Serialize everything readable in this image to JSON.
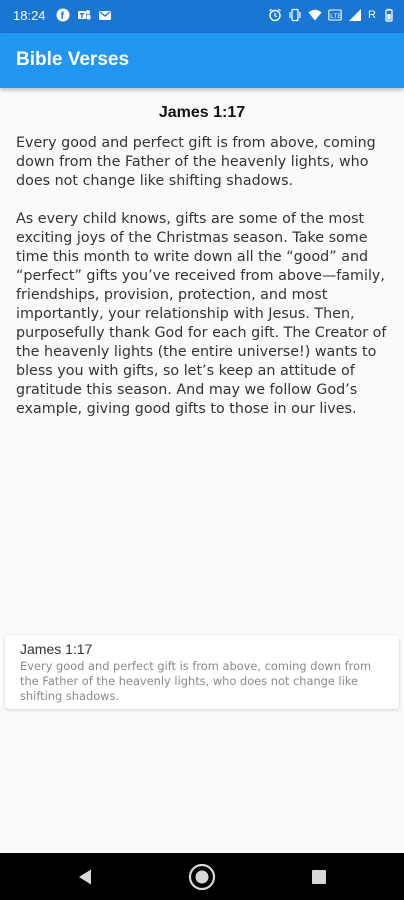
{
  "status_bar": {
    "time": "18:24",
    "roaming": "R",
    "icons_left": [
      "f-notification-icon",
      "teams-icon",
      "mail-icon"
    ],
    "icons_right": [
      "alarm-icon",
      "vibrate-icon",
      "wifi-icon",
      "volte-icon",
      "signal-icon",
      "battery-icon"
    ]
  },
  "app_bar": {
    "title": "Bible Verses"
  },
  "verse": {
    "reference": "James 1:17",
    "text": "Every good and perfect gift is from above, coming down from the Father of the heavenly lights, who does not change like shifting shadows.",
    "devotional": "As every child knows, gifts are some of the most exciting joys of the Christmas season. Take some time this month to write down all the “good” and “perfect” gifts you’ve received from above—family, friendships, provision, protection, and most importantly, your relationship with Jesus. Then, purposefully thank God for each gift. The Creator of the heavenly lights (the entire universe!) wants to bless you with gifts, so let’s keep an attitude of gratitude this season. And may we follow God’s example, giving good gifts to those in our lives."
  },
  "list_card": {
    "title": "James 1:17",
    "subtitle": "Every good and perfect gift is from above, coming down from the Father of the heavenly lights, who does not change like shifting shadows."
  },
  "nav_bar": {
    "buttons": [
      "back-icon",
      "home-icon",
      "recents-icon"
    ]
  },
  "colors": {
    "status_bar": "#1976d2",
    "app_bar": "#2196f3",
    "background": "#fafafa",
    "nav_bar": "#000000"
  }
}
